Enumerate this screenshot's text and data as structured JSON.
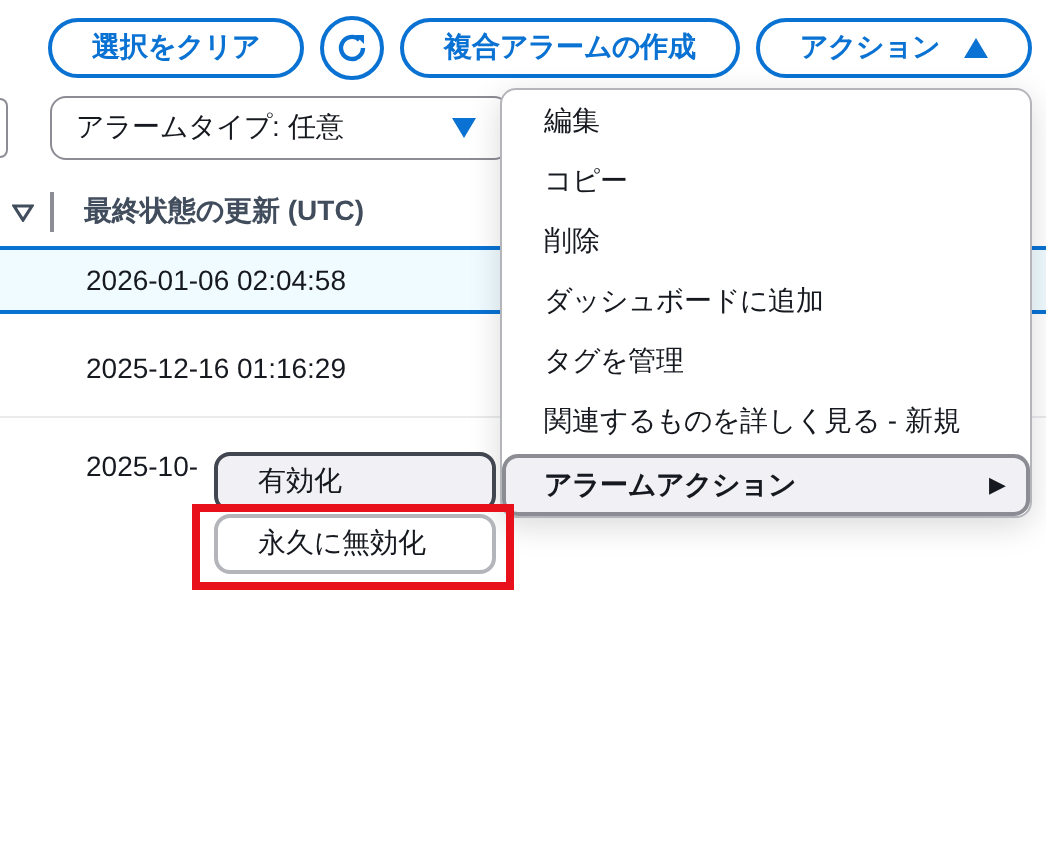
{
  "toolbar": {
    "buttons": [
      {
        "kind": "text",
        "label": "選択をクリア"
      },
      {
        "kind": "refresh"
      },
      {
        "kind": "text",
        "label": "複合アラームの作成"
      },
      {
        "kind": "dropdown",
        "label": "アクション",
        "expanded": true
      }
    ]
  },
  "filter": {
    "dropdown": {
      "value": "アラームタイプ: 任意"
    }
  },
  "table": {
    "columns": [
      {
        "label": "最終状態の更新 (UTC)"
      }
    ],
    "rows": [
      {
        "cells": [
          "2026-01-06 02:04:58"
        ],
        "selected": true
      },
      {
        "cells": [
          "2025-12-16 01:16:29"
        ],
        "selected": false
      },
      {
        "cells": [
          "2025-10-"
        ],
        "selected": false
      }
    ]
  },
  "menu": {
    "items": [
      {
        "label": "編集",
        "kind": "item",
        "highlighted": false
      },
      {
        "label": "コピー",
        "kind": "item",
        "highlighted": false
      },
      {
        "label": "削除",
        "kind": "item",
        "highlighted": false
      },
      {
        "label": "ダッシュボードに追加",
        "kind": "item",
        "highlighted": false
      },
      {
        "label": "タグを管理",
        "kind": "item",
        "highlighted": false
      },
      {
        "label": "関連するものを詳しく見る - 新規",
        "kind": "item",
        "highlighted": false
      },
      {
        "label": "アラームアクション",
        "kind": "submenu",
        "highlighted": true,
        "arrow": "▶"
      }
    ]
  },
  "submenu": {
    "items": [
      {
        "label": "有効化",
        "highlighted": true
      },
      {
        "label": "永久に無効化",
        "highlighted": false
      }
    ]
  },
  "annotation": {
    "kind": "highlight",
    "color": "#e8101a"
  }
}
